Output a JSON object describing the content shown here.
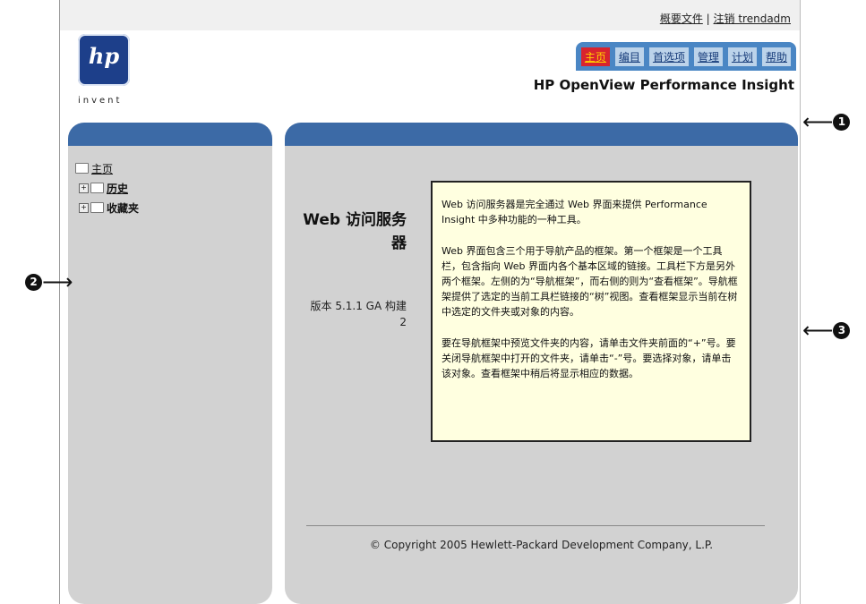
{
  "header": {
    "links": [
      "概要文件",
      "注销 trendadm"
    ],
    "separator": "|",
    "logo_text": "hp",
    "logo_tagline": "invent",
    "product_name": "HP OpenView Performance Insight"
  },
  "nav": {
    "tabs": [
      "主页",
      "编目",
      "首选项",
      "管理",
      "计划",
      "帮助"
    ],
    "active": "主页"
  },
  "tree": {
    "root": "主页",
    "items": [
      "历史",
      "收藏夹"
    ]
  },
  "main": {
    "title": "Web 访问服务器",
    "version": "版本 5.1.1 GA 构建 2",
    "paragraphs": [
      "Web 访问服务器是完全通过 Web 界面来提供 Performance Insight 中多种功能的一种工具。",
      "Web 界面包含三个用于导航产品的框架。第一个框架是一个工具栏，包含指向 Web 界面内各个基本区域的链接。工具栏下方是另外两个框架。左侧的为“导航框架”，而右侧的则为“查看框架”。导航框架提供了选定的当前工具栏链接的“树”视图。查看框架显示当前在树中选定的文件夹或对象的内容。",
      "要在导航框架中预览文件夹的内容，请单击文件夹前面的“+”号。要关闭导航框架中打开的文件夹，请单击“-”号。要选择对象，请单击该对象。查看框架中稍后将显示相应的数据。"
    ],
    "copyright": "© Copyright 2005 Hewlett-Packard Development Company, L.P."
  },
  "callouts": [
    "1",
    "2",
    "3"
  ],
  "colors": {
    "nav_bar": "#4a86c4",
    "panel_bar": "#3c6aa6",
    "panel_bg": "#d2d2d2",
    "info_bg": "#ffffe0",
    "active_tab": "#d8242e"
  }
}
